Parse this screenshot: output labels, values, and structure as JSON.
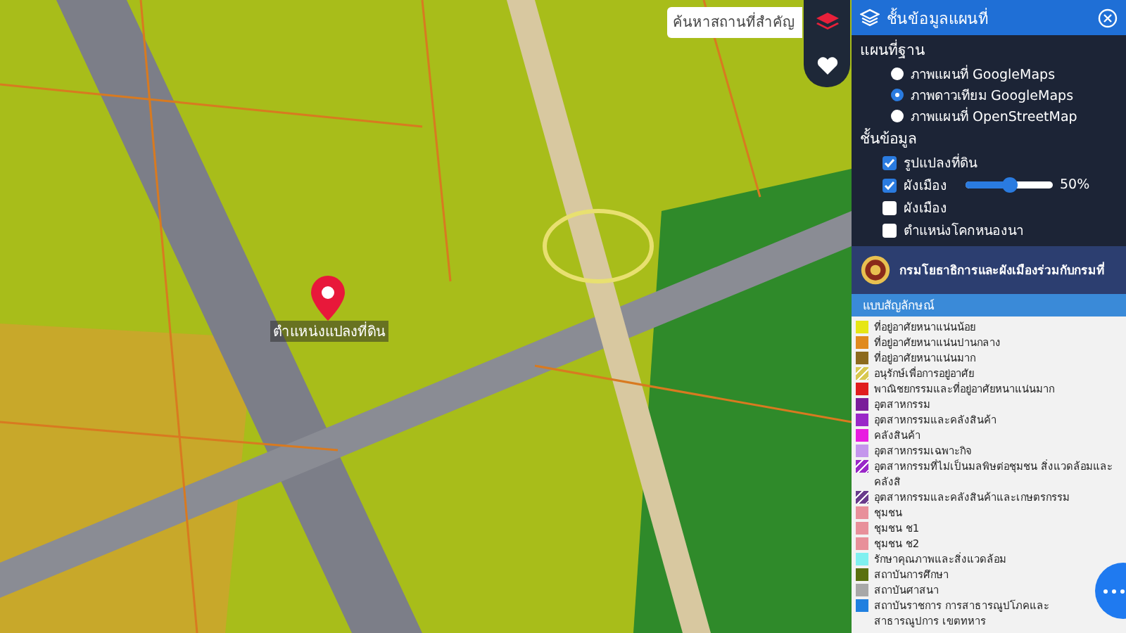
{
  "search": {
    "placeholder": "ค้นหาสถานที่สำคัญ"
  },
  "marker": {
    "label": "ตำแหน่งแปลงที่ดิน"
  },
  "panel": {
    "title": "ชั้นข้อมูลแผนที่",
    "base_map": {
      "heading": "แผนที่ฐาน",
      "options": [
        {
          "label": "ภาพแผนที่ GoogleMaps",
          "selected": false
        },
        {
          "label": "ภาพดาวเทียม GoogleMaps",
          "selected": true
        },
        {
          "label": "ภาพแผนที่ OpenStreetMap",
          "selected": false
        }
      ]
    },
    "layers": {
      "heading": "ชั้นข้อมูล",
      "items": [
        {
          "label": "รูปแปลงที่ดิน",
          "checked": true
        },
        {
          "label": "ผังเมือง",
          "checked": true,
          "level": 0.5,
          "reading": "50%"
        },
        {
          "label": "ผังเมือง",
          "checked": false
        },
        {
          "label": "ตำแหน่งโคกหนองนา",
          "checked": false
        }
      ]
    }
  },
  "legend": {
    "agency": "กรมโยธาธิการและผังเมืองร่วมกับกรมที่",
    "heading": "แบบสัญลักษณ์",
    "items": [
      {
        "label": "ที่อยู่อาศัยหนาแน่นน้อย",
        "color": "#e6e614",
        "kind": "solid"
      },
      {
        "label": "ที่อยู่อาศัยหนาแน่นปานกลาง",
        "color": "#e08a1e",
        "kind": "solid"
      },
      {
        "label": "ที่อยู่อาศัยหนาแน่นมาก",
        "color": "#8c6a1e",
        "kind": "solid"
      },
      {
        "label": "อนุรักษ์เพื่อการอยู่อาศัย",
        "color": "#d8c850",
        "kind": "hatched"
      },
      {
        "label": "พาณิชยกรรมและที่อยู่อาศัยหนาแน่นมาก",
        "color": "#e01e1e",
        "kind": "solid"
      },
      {
        "label": "อุตสาหกรรม",
        "color": "#7a1e9a",
        "kind": "solid"
      },
      {
        "label": "อุตสาหกรรมและคลังสินค้า",
        "color": "#9a28c8",
        "kind": "solid"
      },
      {
        "label": "คลังสินค้า",
        "color": "#e81ee0",
        "kind": "solid"
      },
      {
        "label": "อุตสาหกรรมเฉพาะกิจ",
        "color": "#c496ec",
        "kind": "solid"
      },
      {
        "label": "อุตสาหกรรมที่ไม่เป็นมลพิษต่อชุมชน สิ่งแวดล้อมและคลังสิ",
        "color": "#9a28c8",
        "kind": "hatched"
      },
      {
        "label": "อุตสาหกรรมและคลังสินค้าและเกษตรกรรม",
        "color": "#6a3c8c",
        "kind": "hatched"
      },
      {
        "label": "ชุมชน",
        "color": "#e8909a",
        "kind": "solid"
      },
      {
        "label": "ชุมชน ช1",
        "color": "#e8909a",
        "kind": "solid"
      },
      {
        "label": "ชุมชน ช2",
        "color": "#e8909a",
        "kind": "solid"
      },
      {
        "label": "รักษาคุณภาพและสิ่งแวดล้อม",
        "color": "#80f0f0",
        "kind": "solid"
      },
      {
        "label": "สถาบันการศึกษา",
        "color": "#5a7010",
        "kind": "solid"
      },
      {
        "label": "สถาบันศาสนา",
        "color": "#a8a8a8",
        "kind": "solid"
      },
      {
        "label": "สถาบันราชการ การสาธารณูปโภคและสาธารณูปการ เขตทหาร",
        "color": "#2080e0",
        "kind": "solid"
      }
    ]
  }
}
